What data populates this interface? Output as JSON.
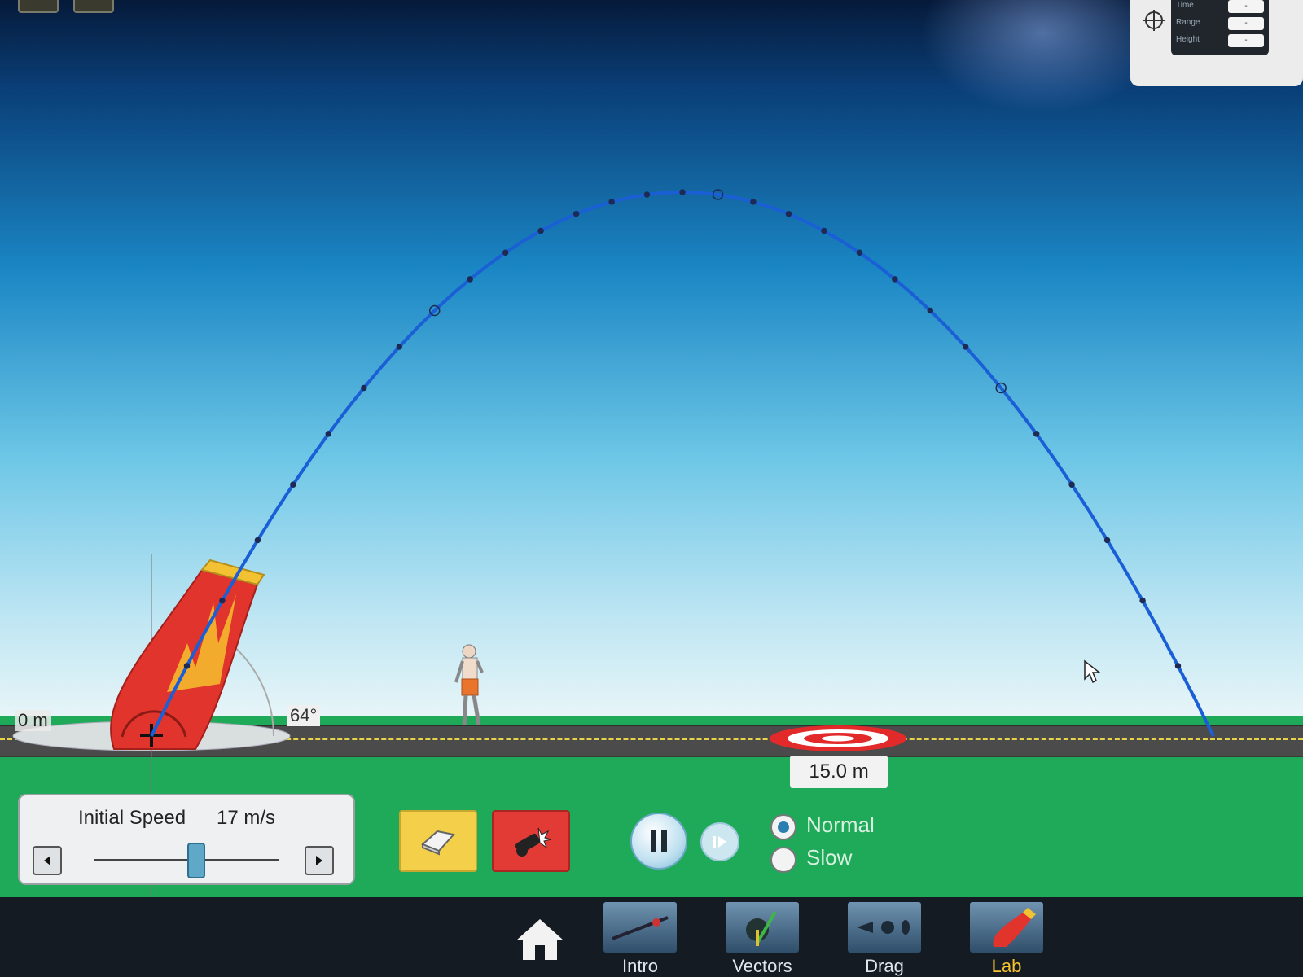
{
  "readout": {
    "labels": [
      "Time",
      "Range",
      "Height"
    ],
    "values": [
      "-",
      "-",
      "-"
    ]
  },
  "scene": {
    "origin_label": "0 m",
    "angle_label": "64°",
    "target_distance": "15.0 m"
  },
  "controls": {
    "speed_title": "Initial Speed",
    "speed_value": "17 m/s",
    "speed_mps": 17,
    "erase_icon": "eraser-icon",
    "fire_icon": "cannon-fire-icon",
    "play_state": "pause-icon",
    "step_icon": "step-forward-icon",
    "speed_modes": [
      {
        "label": "Normal",
        "selected": true
      },
      {
        "label": "Slow",
        "selected": false
      }
    ]
  },
  "nav": {
    "items": [
      {
        "label": "Intro",
        "active": false
      },
      {
        "label": "Vectors",
        "active": false
      },
      {
        "label": "Drag",
        "active": false
      },
      {
        "label": "Lab",
        "active": true
      }
    ],
    "active_color": "#f5c330"
  },
  "colors": {
    "trajectory": "#1a5fd6",
    "grass": "#1faa5a",
    "cannon": "#e0342c"
  }
}
